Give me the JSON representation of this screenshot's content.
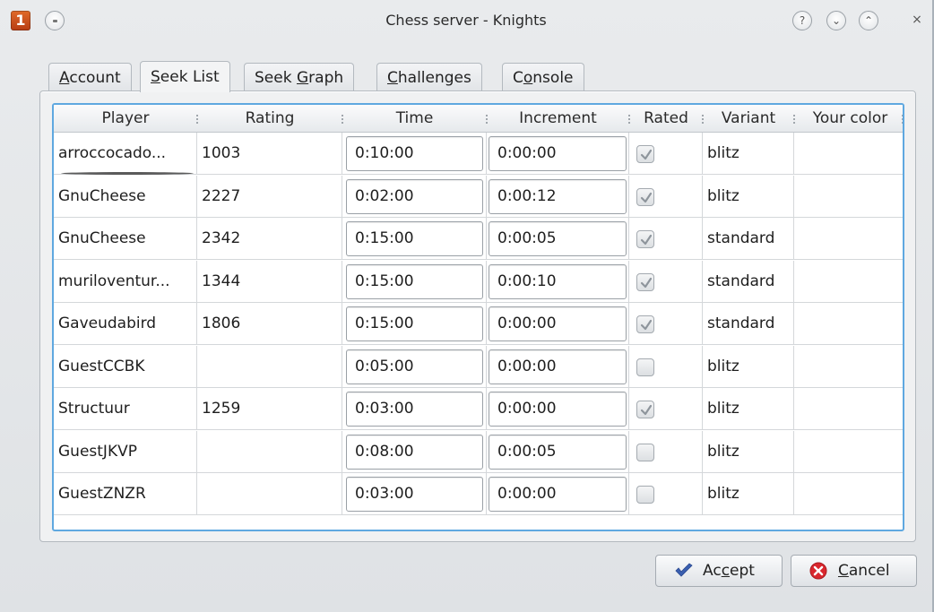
{
  "window": {
    "title": "Chess server - Knights",
    "app_icon_glyph": "1",
    "help_glyph": "?",
    "minimize_glyph": "⌄",
    "maximize_glyph": "⌃",
    "close_glyph": "×"
  },
  "tabs": [
    {
      "pre": "",
      "key": "A",
      "post": "ccount"
    },
    {
      "pre": "",
      "key": "S",
      "post": "eek List"
    },
    {
      "pre": "Seek ",
      "key": "G",
      "post": "raph"
    },
    {
      "pre": "",
      "key": "C",
      "post": "hallenges"
    },
    {
      "pre": "C",
      "key": "o",
      "post": "nsole"
    }
  ],
  "table": {
    "columns": [
      "Player",
      "Rating",
      "Time",
      "Increment",
      "Rated",
      "Variant",
      "Your color"
    ],
    "rows": [
      {
        "player": "arroccocado...",
        "rating": "1003",
        "time": "0:10:00",
        "increment": "0:00:00",
        "rated": true,
        "variant": "blitz"
      },
      {
        "player": "GnuCheese",
        "rating": "2227",
        "time": "0:02:00",
        "increment": "0:00:12",
        "rated": true,
        "variant": "blitz"
      },
      {
        "player": "GnuCheese",
        "rating": "2342",
        "time": "0:15:00",
        "increment": "0:00:05",
        "rated": true,
        "variant": "standard"
      },
      {
        "player": "muriloventur...",
        "rating": "1344",
        "time": "0:15:00",
        "increment": "0:00:10",
        "rated": true,
        "variant": "standard"
      },
      {
        "player": "Gaveudabird",
        "rating": "1806",
        "time": "0:15:00",
        "increment": "0:00:00",
        "rated": true,
        "variant": "standard"
      },
      {
        "player": "GuestCCBK",
        "rating": "",
        "time": "0:05:00",
        "increment": "0:00:00",
        "rated": false,
        "variant": "blitz"
      },
      {
        "player": "Structuur",
        "rating": "1259",
        "time": "0:03:00",
        "increment": "0:00:00",
        "rated": true,
        "variant": "blitz"
      },
      {
        "player": "GuestJKVP",
        "rating": "",
        "time": "0:08:00",
        "increment": "0:00:05",
        "rated": false,
        "variant": "blitz"
      },
      {
        "player": "GuestZNZR",
        "rating": "",
        "time": "0:03:00",
        "increment": "0:00:00",
        "rated": false,
        "variant": "blitz"
      }
    ]
  },
  "buttons": {
    "accept": {
      "pre": "Ac",
      "key": "c",
      "post": "ept",
      "icon": "checkmark-icon",
      "color": "#3a5fb0"
    },
    "cancel": {
      "pre": "",
      "key": "C",
      "post": "ancel",
      "icon": "cancel-icon",
      "color": "#d9272e"
    }
  },
  "colors": {
    "focus_border": "#5fa8e0",
    "check_mark": "#8e959c"
  }
}
